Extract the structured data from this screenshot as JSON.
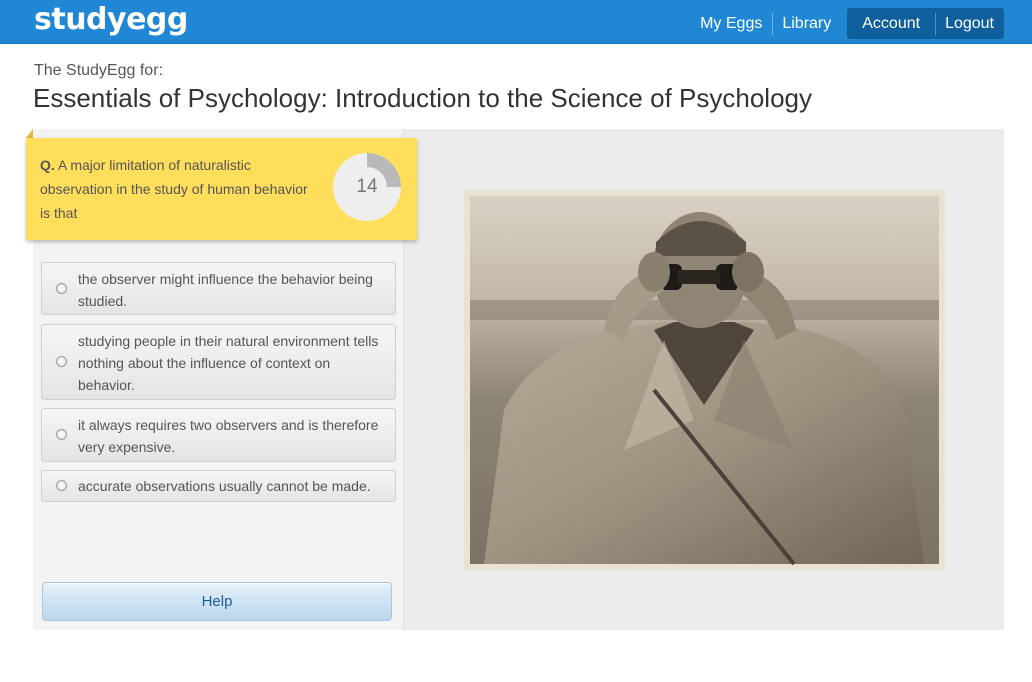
{
  "header": {
    "logo": "studyegg",
    "nav": [
      "My Eggs",
      "Library",
      "Account",
      "Logout"
    ]
  },
  "page": {
    "subtitle": "The StudyEgg for:",
    "title": "Essentials of Psychology: Introduction to the Science of Psychology"
  },
  "question": {
    "prefix": "Q.",
    "text": "A major limitation of naturalistic observation in the study of human behavior is that",
    "timer": "14",
    "timer_fraction": 0.25
  },
  "answers": [
    "the observer might influence the behavior being studied.",
    "studying people in their natural environment tells nothing about the influence of context on behavior.",
    "it always requires two observers and is therefore very expensive.",
    "accurate observations usually cannot be made."
  ],
  "help_label": "Help",
  "colors": {
    "header": "#1f87d4",
    "active_nav": "#0f5f9c",
    "question_card": "#ffde5c"
  }
}
